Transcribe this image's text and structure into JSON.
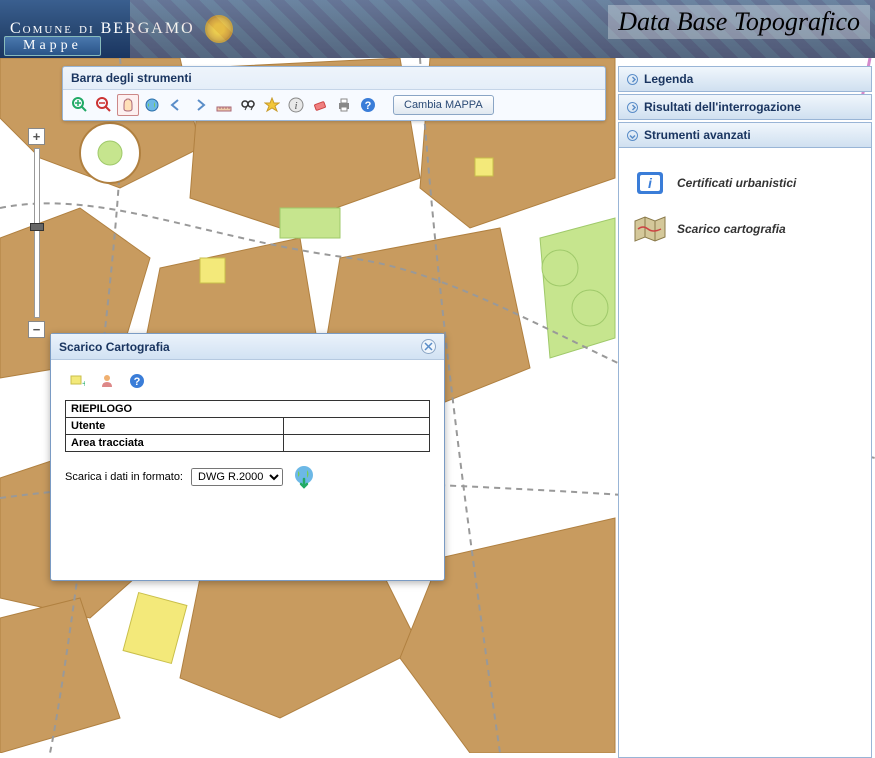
{
  "header": {
    "municipality": "Comune di BERGAMO",
    "app_title": "Data Base Topografico",
    "section": "Mappe"
  },
  "toolbar": {
    "title": "Barra degli strumenti",
    "change_map": "Cambia MAPPA",
    "tools": {
      "zoom_in": "zoom-in",
      "zoom_out": "zoom-out",
      "pan": "pan",
      "zoom_world": "zoom-world",
      "prev": "previous-view",
      "next": "next-view",
      "measure": "measure",
      "find": "find",
      "favorite": "favorite",
      "info": "identify",
      "erase": "erase",
      "print": "print",
      "help": "help"
    }
  },
  "side": {
    "legend": "Legenda",
    "query_results": "Risultati dell'interrogazione",
    "advanced_tools": "Strumenti avanzati",
    "items": {
      "certificates": "Certificati urbanistici",
      "download": "Scarico cartografia"
    }
  },
  "dialog": {
    "title": "Scarico Cartografia",
    "summary": "RIEPILOGO",
    "user": "Utente",
    "area": "Area tracciata",
    "download_label": "Scarica i dati in formato:",
    "format_selected": "DWG R.2000",
    "format_options": [
      "DWG R.2000"
    ]
  }
}
